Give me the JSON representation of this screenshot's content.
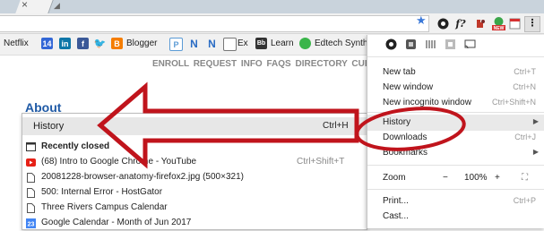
{
  "tabstrip": {
    "close_glyph": "×"
  },
  "toolbar": {
    "star_icon": "star-icon",
    "extensions": [
      "chrome-circle-icon",
      "f-script-icon",
      "red-extension-icon",
      "rss-new-icon",
      "calendar-icon"
    ],
    "ext_glyph_f": "f?",
    "new_badge": "NEW",
    "menu_glyph": "⋮"
  },
  "bookmarks": {
    "items": [
      {
        "label": "Netflix",
        "icon": null
      },
      {
        "label": "",
        "icon": "calendar-14-icon",
        "badge": "14",
        "color": "#3367d6"
      },
      {
        "label": "",
        "icon": "linkedin-icon",
        "badge": "in",
        "color": "#0e76a8"
      },
      {
        "label": "",
        "icon": "facebook-icon",
        "badge": "f",
        "color": "#3b5998"
      },
      {
        "label": "",
        "icon": "twitter-icon",
        "badge": "🐦",
        "color": "#1da1f2"
      },
      {
        "label": "Blogger",
        "icon": "blogger-icon",
        "badge": "B",
        "color": "#f57d00"
      },
      {
        "label": "",
        "icon": "p-icon",
        "badge": "P",
        "color": "#5b9bd5"
      },
      {
        "label": "",
        "icon": "n-icon-1",
        "badge": "N",
        "color": "#2a6cc4"
      },
      {
        "label": "",
        "icon": "n-icon-2",
        "badge": "N",
        "color": "#2a6cc4"
      },
      {
        "label": "Ex",
        "icon": "ex-icon",
        "badge": "",
        "color": "#777"
      },
      {
        "label": "Learn",
        "icon": "learn-icon",
        "badge": "Bb",
        "color": "#333"
      },
      {
        "label": "Edtech Synthesis",
        "icon": "edtech-icon",
        "badge": "",
        "color": "#3ab54a"
      }
    ]
  },
  "page": {
    "site_nav": "ENROLL  REQUEST INFO  FAQS  DIRECTORY  CUR",
    "about": "About"
  },
  "history_submenu": {
    "header_label": "History",
    "header_shortcut": "Ctrl+H",
    "rows": [
      {
        "label": "Recently closed",
        "shortcut": "",
        "icon": "window-icon",
        "bold": true
      },
      {
        "label": "(68) Intro to Google Chrome - YouTube",
        "shortcut": "Ctrl+Shift+T",
        "icon": "youtube-icon",
        "bold": false
      },
      {
        "label": "20081228-browser-anatomy-firefox2.jpg (500×321)",
        "shortcut": "",
        "icon": "page-icon",
        "bold": false
      },
      {
        "label": "500: Internal Error - HostGator",
        "shortcut": "",
        "icon": "page-icon",
        "bold": false
      },
      {
        "label": "Three Rivers Campus Calendar",
        "shortcut": "",
        "icon": "page-icon",
        "bold": false
      },
      {
        "label": "Google Calendar - Month of Jun 2017",
        "shortcut": "",
        "icon": "google-calendar-icon",
        "bold": false
      }
    ]
  },
  "main_menu": {
    "items": [
      {
        "label": "New tab",
        "shortcut": "Ctrl+T"
      },
      {
        "label": "New window",
        "shortcut": "Ctrl+N"
      },
      {
        "label": "New incognito window",
        "shortcut": "Ctrl+Shift+N"
      },
      {
        "label": "History",
        "shortcut": "",
        "submenu": true
      },
      {
        "label": "Downloads",
        "shortcut": "Ctrl+J"
      },
      {
        "label": "Bookmarks",
        "shortcut": "",
        "submenu": true
      },
      {
        "label": "Zoom",
        "shortcut": ""
      },
      {
        "label": "Print...",
        "shortcut": "Ctrl+P"
      },
      {
        "label": "Cast...",
        "shortcut": ""
      }
    ],
    "zoom": {
      "minus": "−",
      "value": "100%",
      "plus": "+",
      "fullscreen": "⛶"
    }
  },
  "colors": {
    "annotation_red": "#c0141c",
    "link_blue": "#1f5aa6"
  }
}
